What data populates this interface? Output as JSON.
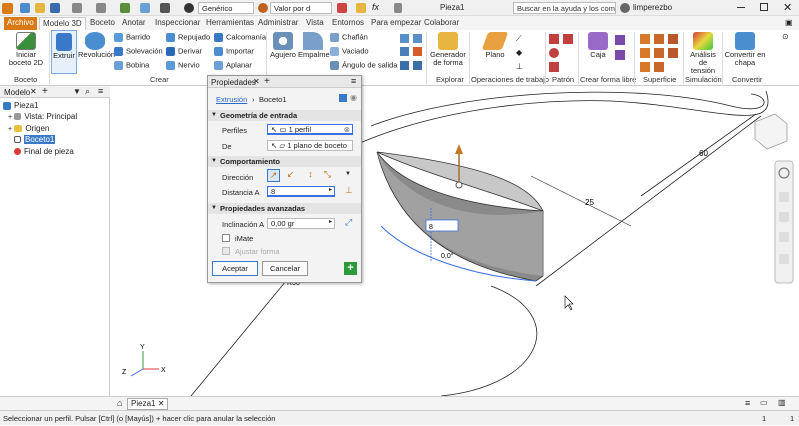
{
  "titlebar": {
    "material": "Genérico",
    "appearance": "Valor por d",
    "document_title": "Pieza1",
    "search_placeholder": "Buscar en la ayuda y los comand",
    "user": "limperezbo",
    "fx": "fx"
  },
  "tabs": [
    "Archivo",
    "Modelo 3D",
    "Boceto",
    "Anotar",
    "Inspeccionar",
    "Herramientas",
    "Administrar",
    "Vista",
    "Entornos",
    "Para empezar",
    "Colaborar"
  ],
  "ribbon": {
    "boceto": {
      "btn": "Iniciar\nboceto 2D",
      "panel": "Boceto"
    },
    "crear": {
      "extruir": "Extruir",
      "revolucion": "Revolución",
      "barrido": "Barrido",
      "seleccion": "Solevación",
      "bobina": "Bobina",
      "repujado": "Repujado",
      "derivar": "Derivar",
      "nervio": "Nervio",
      "calcomania": "Calcomanía",
      "importar": "Importar",
      "aplanar": "Aplanar",
      "panel": "Crear"
    },
    "modificar": {
      "agujero": "Agujero",
      "empalme": "Empalme",
      "chaflan": "Chaflán",
      "vaciado": "Vaciado",
      "angulo": "Ángulo de salida"
    },
    "explorar": {
      "btn": "Generador\nde forma",
      "panel": "Explorar"
    },
    "trabajo": {
      "btn": "Plano",
      "panel": "Operaciones de trabajo"
    },
    "patron": {
      "panel": "Patrón"
    },
    "forma_libre": {
      "btn": "Caja",
      "panel": "Crear forma libre"
    },
    "superficie": {
      "panel": "Superficie"
    },
    "simulacion": {
      "btn": "Análisis\nde tensión",
      "panel": "Simulación"
    },
    "convertir": {
      "btn": "Convertir en\nchapa",
      "panel": "Convertir"
    }
  },
  "browser": {
    "tab": "Modelo",
    "items": [
      "Pieza1",
      "Vista: Principal",
      "Origen",
      "Boceto1",
      "Final de pieza"
    ]
  },
  "props": {
    "tab": "Propiedades",
    "breadcrumb_link": "Extrusión",
    "breadcrumb_current": "Boceto1",
    "section_geom": "Geometría de entrada",
    "perfiles_label": "Perfiles",
    "perfiles_value": "1 perfil",
    "de_label": "De",
    "de_value": "1 plano de boceto",
    "section_comp": "Comportamiento",
    "direccion_label": "Dirección",
    "distancia_label": "Distancia A",
    "distancia_value": "8",
    "section_adv": "Propiedades avanzadas",
    "inclinacion_label": "Inclinación A",
    "inclinacion_value": "0,00 gr",
    "imate": "iMate",
    "ajustar": "Ajustar forma",
    "aceptar": "Aceptar",
    "cancelar": "Cancelar"
  },
  "viewport": {
    "dim_60": "60",
    "dim_25": "25",
    "dim_r60": "R60",
    "extrude_value": "8",
    "angle_value": "0,0°",
    "axis_x": "X",
    "axis_y": "Y",
    "axis_z": "Z"
  },
  "bottom": {
    "doc_tab": "Pieza1",
    "status": "Seleccionar un perfil. Pulsar [Ctrl] (o [Mayús]) + hacer clic para anular la selección",
    "page_count": "1",
    "page_count_2": "1"
  }
}
